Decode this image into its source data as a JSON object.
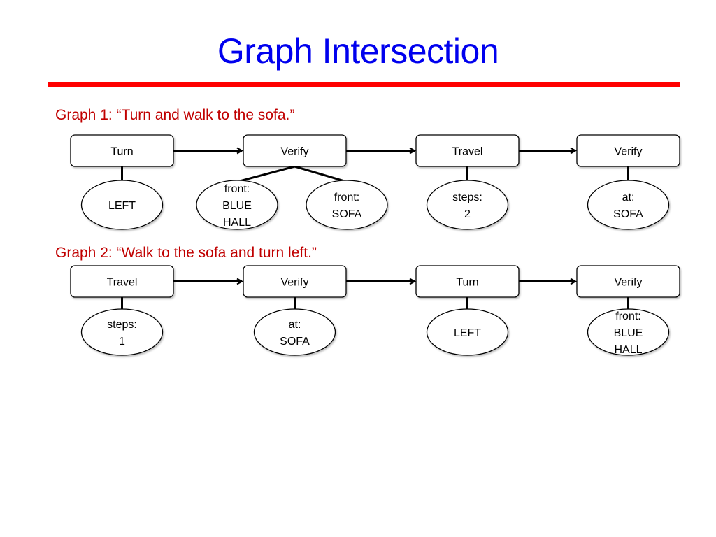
{
  "slide": {
    "title": "Graph Intersection",
    "accent_color": "#ff0000",
    "title_color": "#0000ee",
    "caption_color": "#c00000"
  },
  "graphs": [
    {
      "caption": "Graph 1: “Turn and walk to the sofa.”",
      "actions": [
        {
          "label": "Turn",
          "params": [
            [
              "LEFT"
            ]
          ]
        },
        {
          "label": "Verify",
          "params": [
            [
              "front:",
              "BLUE",
              "HALL"
            ],
            [
              "front:",
              "SOFA"
            ]
          ]
        },
        {
          "label": "Travel",
          "params": [
            [
              "steps:",
              "2"
            ]
          ]
        },
        {
          "label": "Verify",
          "params": [
            [
              "at:",
              "SOFA"
            ]
          ]
        }
      ]
    },
    {
      "caption": "Graph 2: “Walk to the sofa and turn left.”",
      "actions": [
        {
          "label": "Travel",
          "params": [
            [
              "steps:",
              "1"
            ]
          ]
        },
        {
          "label": "Verify",
          "params": [
            [
              "at:",
              "SOFA"
            ]
          ]
        },
        {
          "label": "Turn",
          "params": [
            [
              "LEFT"
            ]
          ]
        },
        {
          "label": "Verify",
          "params": [
            [
              "front:",
              "BLUE",
              "HALL"
            ]
          ]
        }
      ]
    }
  ]
}
